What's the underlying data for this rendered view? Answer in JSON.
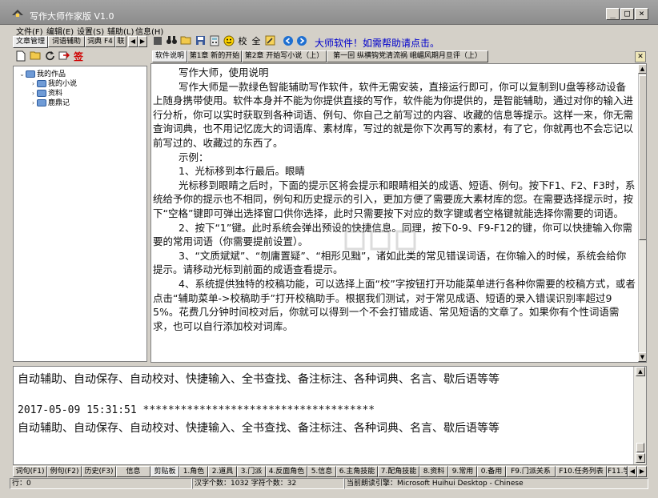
{
  "window": {
    "title": "写作大师作家版  V1.0",
    "buttons": [
      "_",
      "□",
      "×"
    ]
  },
  "menubar": [
    "文件(F)",
    "编辑(E)",
    "设置(S)",
    "辅助(L)",
    "信息(H)"
  ],
  "left_panel": {
    "tabs": [
      "文章管理",
      "词语辅助",
      "词典 F4",
      "联"
    ],
    "tree": {
      "root": "我的作品",
      "children": [
        "我的小说",
        "资料",
        "鹿鼎记"
      ]
    }
  },
  "main_toolbar": {
    "help_text": "大师软件！如需帮助请点击。",
    "icons": [
      "binoculars-icon",
      "open-folder-icon",
      "save-icon",
      "calculator-icon",
      "smiley-icon",
      "proofread-icon",
      "full-icon",
      "pencil-icon",
      "back-icon",
      "forward-icon"
    ],
    "proofread_label": "校",
    "full_label": "全"
  },
  "doc_tabs": [
    "软件说明",
    "第1章 新的开始",
    "第2章 开始写小说（上）",
    "第一回  纵横钩党清流祸  峨嵋风期月旦评（上）"
  ],
  "editor": {
    "paragraphs": [
      "写作大师，使用说明",
      "写作大师是一款绿色智能辅助写作软件，软件无需安装，直接运行即可，你可以复制到U盘等移动设备上随身携带使用。软件本身并不能为你提供直接的写作，软件能为你提供的，是智能辅助，通过对你的输入进行分析，你可以实时获取到各种词语、例句、你自己之前写过的内容、收藏的信息等提示。这样一来，你无需查询词典，也不用记忆庞大的词语库、素材库，写过的就是你下次再写的素材，有了它，你就再也不会忘记以前写过的、收藏过的东西了。",
      "示例：",
      "1、光标移到本行最后。眼睛",
      "光标移到眼睛之后时，下面的提示区将会提示和眼睛相关的成语、短语、例句。按下F1、F2、F3时，系统给予你的提示也不相同，例句和历史提示的引入，更加方便了需要庞大素材库的您。在需要选择提示时，按下“空格”键即可弹出选择窗口供你选择，此时只需要按下对应的数字键或者空格键就能选择你需要的词语。",
      "2、按下“1”键。此时系统会弹出预设的快捷信息。同理，按下0-9、F9-F12的键，你可以快捷输入你需要的常用词语（你需要提前设置）。",
      "3、“文质斌斌”、“刎庸置疑”、“相形见黜”，诸如此类的常见错误词语，在你输入的时候，系统会给你提示。请移动光标到前面的成语查看提示。",
      "4、系统提供独特的校稿功能，可以选择上面“校”字按钮打开功能菜单进行各种你需要的校稿方式，或者点击“辅助菜单->校稿助手”打开校稿助手。根据我们测试，对于常见成语、短语的录入错误识别率超过95%。花费几分钟时间校对后，你就可以得到一个不会打错成语、常见短语的文章了。如果你有个性词语需求，也可以自行添加校对词库。"
    ]
  },
  "lower_panel": {
    "line1": "自动辅助、自动保存、自动校对、快捷输入、全书查找、备注标注、各种词典、名言、歇后语等等",
    "timestamp": "2017-05-09    15:31:51    *************************************",
    "line3": "自动辅助、自动保存、自动校对、快捷输入、全书查找、备注标注、各种词典、名言、歇后语等等"
  },
  "bottom_tabs": [
    "词句(F1)",
    "例句(F2)",
    "历史(F3)",
    "信息",
    "剪贴板",
    "1.角色",
    "2.道具",
    "3.门派",
    "4.反面角色",
    "5.信息",
    "6.主角技能",
    "7.配角技能",
    "8.资料",
    "9.常用",
    "0.备用",
    "F9.门派关系",
    "F10.任务列表",
    "F11.学"
  ],
  "statusbar": {
    "row": "行：0",
    "counts": "汉字个数：1032  字符个数：32",
    "voice": "当前朗读引擎：Microsoft Huihui Desktop - Chinese"
  },
  "colors": {
    "face": "#d4d0c8",
    "title": "#8c8c8c",
    "link": "#0000cc"
  }
}
